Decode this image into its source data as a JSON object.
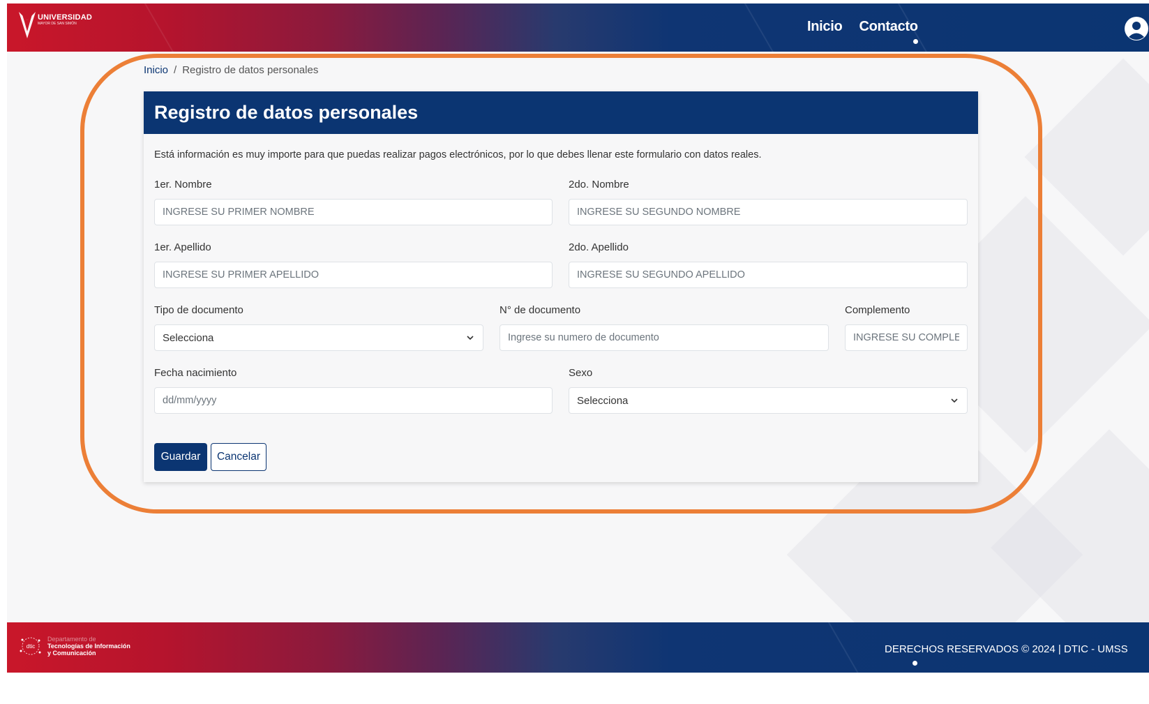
{
  "brand": {
    "name": "UNIVERSIDAD",
    "sub": "MAYOR DE SAN SIMÓN"
  },
  "nav": {
    "items": [
      {
        "label": "Inicio"
      },
      {
        "label": "Contacto"
      }
    ]
  },
  "breadcrumb": {
    "home": "Inicio",
    "separator": "/",
    "current": "Registro de datos personales"
  },
  "form": {
    "title": "Registro de datos personales",
    "intro": "Está información es muy importe para que puedas realizar pagos electrónicos, por lo que debes llenar este formulario con datos reales.",
    "first_name": {
      "label": "1er. Nombre",
      "placeholder": "INGRESE SU PRIMER NOMBRE"
    },
    "second_name": {
      "label": "2do. Nombre",
      "placeholder": "INGRESE SU SEGUNDO NOMBRE"
    },
    "first_surname": {
      "label": "1er. Apellido",
      "placeholder": "INGRESE SU PRIMER APELLIDO"
    },
    "second_surname": {
      "label": "2do. Apellido",
      "placeholder": "INGRESE SU SEGUNDO APELLIDO"
    },
    "doc_type": {
      "label": "Tipo de documento",
      "value": "Selecciona"
    },
    "doc_number": {
      "label": "N° de documento",
      "placeholder": "Ingrese su numero de documento"
    },
    "complement": {
      "label": "Complemento",
      "placeholder": "INGRESE SU COMPLEM"
    },
    "birth_date": {
      "label": "Fecha nacimiento",
      "placeholder": "dd/mm/yyyy"
    },
    "sex": {
      "label": "Sexo",
      "value": "Selecciona"
    },
    "save_label": "Guardar",
    "cancel_label": "Cancelar"
  },
  "footer": {
    "dept_line1": "Departamento de",
    "dept_line2": "Tecnologías de Información",
    "dept_line3": "y Comunicación",
    "dept_badge": "dtic",
    "copyright": "DERECHOS RESERVADOS © 2024 | DTIC - UMSS"
  },
  "colors": {
    "primary": "#0b3572",
    "brand_red": "#c9172a",
    "highlight": "#ec7f37"
  }
}
